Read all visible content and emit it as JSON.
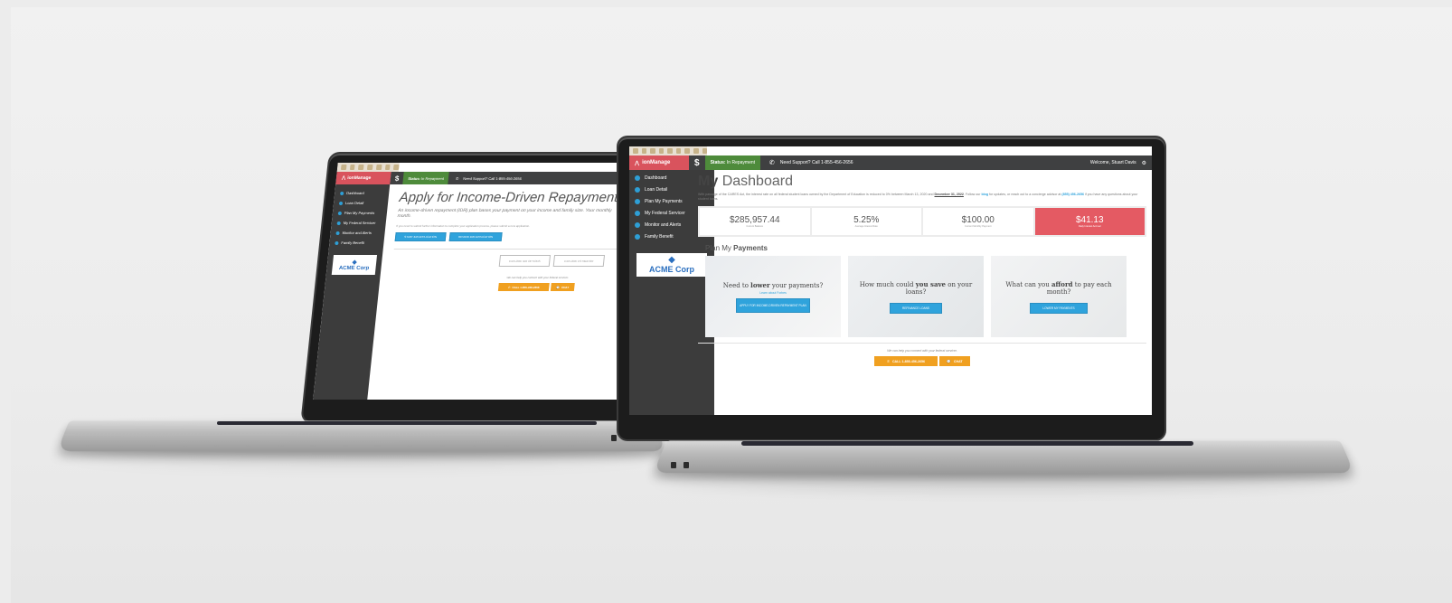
{
  "colors": {
    "brand_red": "#d9535d",
    "status_green": "#4e8b3b",
    "nav_dark": "#3c3c3c",
    "action_blue": "#2fa3dc",
    "contact_orange": "#f0a020",
    "highlight_red": "#e45a63"
  },
  "app": {
    "name": "ionManage",
    "status_label": "Status:",
    "status_value": "In Repayment",
    "support_text": "Need Support? Call 1-855-456-2656",
    "welcome_text": "Welcome, Stuart Davis",
    "logo_text": "ACME Corp"
  },
  "nav": {
    "items": [
      {
        "label": "Dashboard",
        "icon": "dashboard-icon"
      },
      {
        "label": "Loan Detail",
        "icon": "chart-icon"
      },
      {
        "label": "Plan My Payments",
        "icon": "list-icon"
      },
      {
        "label": "My Federal Servicer",
        "icon": "info-icon"
      },
      {
        "label": "Monitor and Alerts",
        "icon": "bell-icon"
      },
      {
        "label": "Family Benefit",
        "icon": "people-icon"
      }
    ]
  },
  "left_screen": {
    "title": "Apply for Income-Driven Repayment",
    "subtitle": "An income-driven repayment (IDR) plan bases your payment on your income and family size. Your monthly",
    "subtitle2": "month.",
    "note": "If you need to submit further information to complete your application process, please submit a new application.",
    "btn_start": "START IDR APPLICATION",
    "btn_review": "REVIEW IDR APPLICATION",
    "btn_options": "EXPLORE IDR OPTIONS",
    "btn_estimate": "EXPLORE ESTIMATOR",
    "help_text": "We can help you connect with your federal servicer.",
    "call_label": "CALL 1-855-456-2656",
    "chat_label": "CHAT"
  },
  "right_screen": {
    "title_bold": "My",
    "title_rest": "Dashboard",
    "intro_1": "With passage of the CARES Act, the interest rate on all federal student loans owned by the Department of Education is reduced to 0% between March 13, 2020 and",
    "intro_date": "December 31, 2022",
    "intro_2": ". Follow our",
    "intro_link": "blog",
    "intro_3": "for",
    "intro_4": "updates, or reach out to a concierge advisor at",
    "intro_phone": "(855) 456-2656",
    "intro_5": "if you have any questions about your student loans.",
    "stats": [
      {
        "value": "$285,957.44",
        "label": "Current Balance"
      },
      {
        "value": "5.25%",
        "label": "Average Interest Rate"
      },
      {
        "value": "$100.00",
        "label": "Current Monthly Payment"
      },
      {
        "value": "$41.13",
        "label": "Daily Interest Accrual"
      }
    ],
    "section_plain": "Plan My",
    "section_bold": "Payments",
    "cards": [
      {
        "q_pre": "Need to ",
        "q_bold": "lower",
        "q_post": " your payments?",
        "link": "Learn about Forbes",
        "button": "APPLY FOR INCOME-DRIVEN REPAYMENT PLAN"
      },
      {
        "q_pre": "How much could ",
        "q_bold": "you save",
        "q_post": " on your loans?",
        "link": "",
        "button": "REFINANCE LOANS"
      },
      {
        "q_pre": "What can you ",
        "q_bold": "afford",
        "q_post": " to pay each month?",
        "link": "",
        "button": "LOWER MY PAYMENTS"
      }
    ],
    "help_text": "We can help you connect with your federal servicer.",
    "call_label": "CALL 1-855-456-2656",
    "chat_label": "CHAT"
  }
}
